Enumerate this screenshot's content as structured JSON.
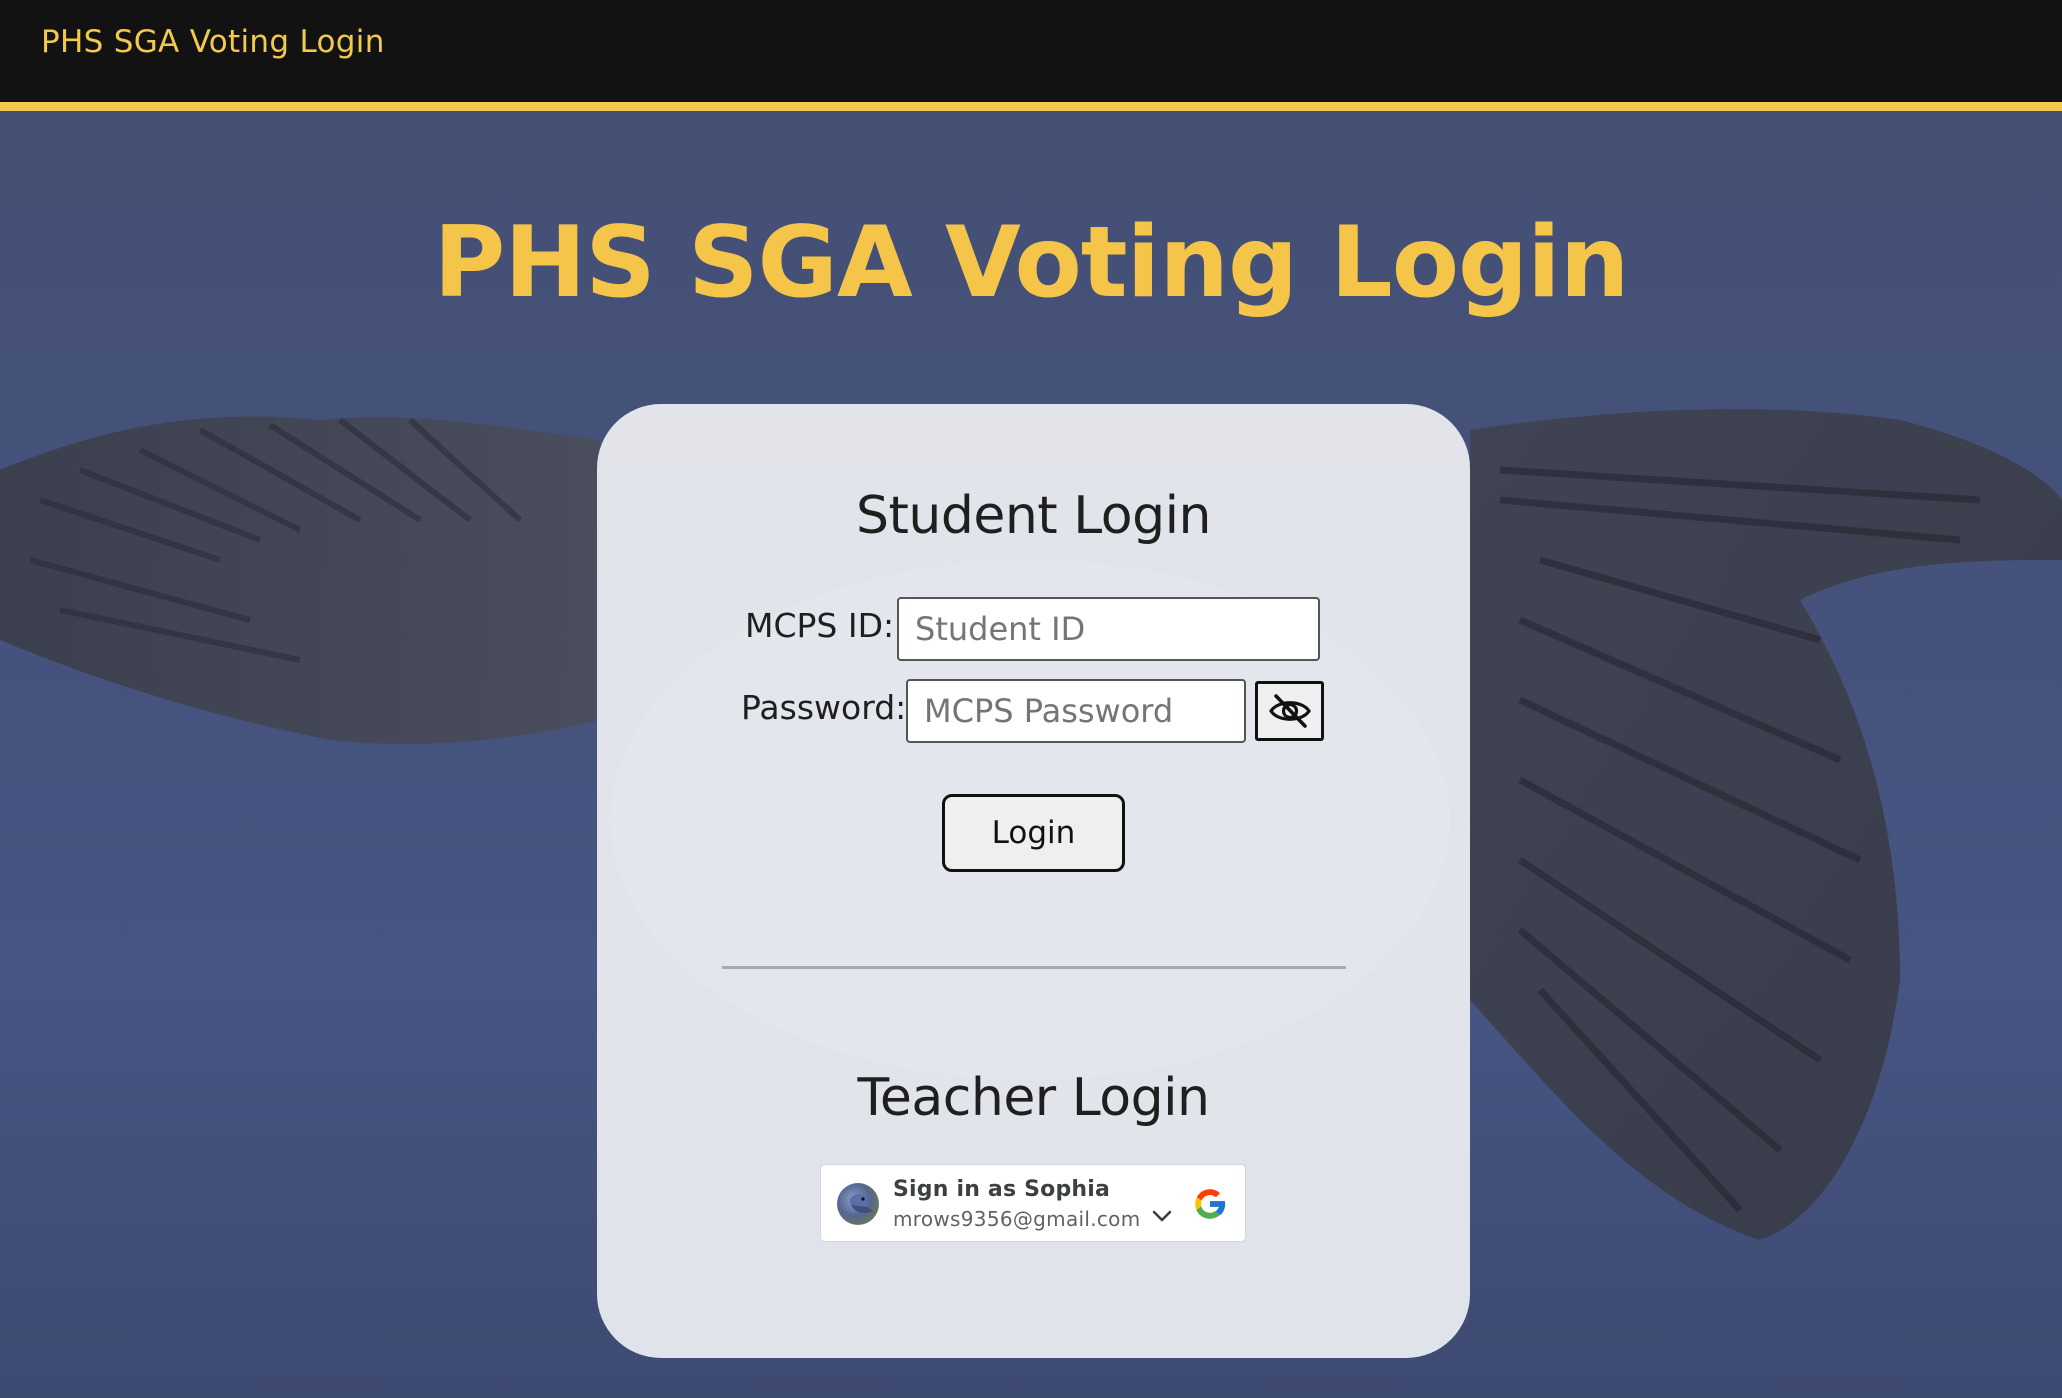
{
  "navbar": {
    "brand": "PHS SGA Voting Login"
  },
  "page": {
    "title": "PHS SGA Voting Login"
  },
  "student_login": {
    "heading": "Student Login",
    "id_label": "MCPS ID:",
    "id_placeholder": "Student ID",
    "password_label": "Password:",
    "password_placeholder": "MCPS Password",
    "toggle_icon": "eye-slash-icon",
    "login_button": "Login"
  },
  "teacher_login": {
    "heading": "Teacher Login",
    "google_signin": {
      "name_line": "Sign in as Sophia",
      "email": "mrows9356@gmail.com",
      "dropdown_icon": "chevron-down-icon",
      "logo_icon": "google-logo-icon"
    }
  },
  "colors": {
    "accent_gold": "#f2c94c",
    "navbar_bg": "#121212",
    "page_bg": "#465277",
    "card_bg": "#eeeff3"
  }
}
